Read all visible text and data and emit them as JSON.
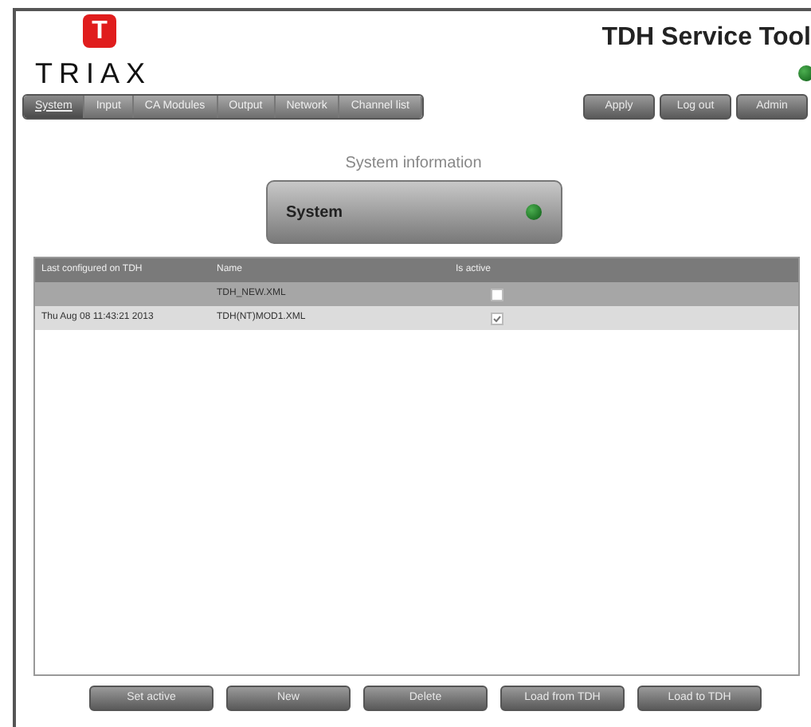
{
  "logo": {
    "mark": "T",
    "wordmark": "TRIAX"
  },
  "app_title": "TDH Service Tool",
  "status": {
    "on": true
  },
  "tabs": [
    {
      "label": "System",
      "selected": true
    },
    {
      "label": "Input",
      "selected": false
    },
    {
      "label": "CA Modules",
      "selected": false
    },
    {
      "label": "Output",
      "selected": false
    },
    {
      "label": "Network",
      "selected": false
    },
    {
      "label": "Channel list",
      "selected": false
    }
  ],
  "actions": [
    "Apply",
    "Log out",
    "Admin"
  ],
  "section_title": "System information",
  "system_panel": {
    "label": "System",
    "on": true
  },
  "table": {
    "columns": [
      "Last configured on TDH",
      "Name",
      "Is active"
    ],
    "rows": [
      {
        "cells": [
          "",
          "TDH_NEW.XML"
        ],
        "checked": false,
        "selected": true
      },
      {
        "cells": [
          "Thu Aug 08 11:43:21 2013",
          "TDH(NT)MOD1.XML"
        ],
        "checked": true,
        "selected": false
      }
    ]
  },
  "buttons": [
    "Set active",
    "New",
    "Delete",
    "Load from TDH",
    "Load to TDH"
  ]
}
